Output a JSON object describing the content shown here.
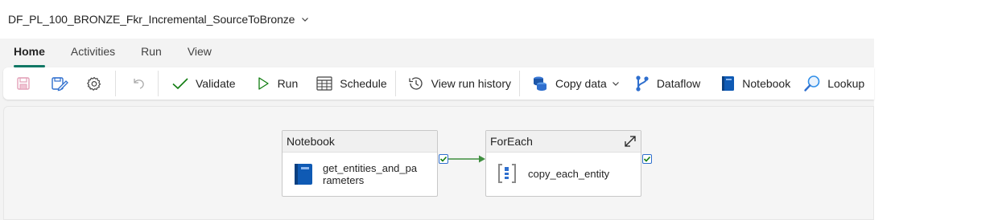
{
  "window": {
    "title": "DF_PL_100_BRONZE_Fkr_Incremental_SourceToBronze"
  },
  "tabs": [
    {
      "label": "Home",
      "active": true
    },
    {
      "label": "Activities",
      "active": false
    },
    {
      "label": "Run",
      "active": false
    },
    {
      "label": "View",
      "active": false
    }
  ],
  "toolbar": {
    "save_icon": "save-icon",
    "save_as_icon": "save-as-icon",
    "settings_icon": "gear-icon",
    "undo_icon": "undo-icon",
    "validate_label": "Validate",
    "run_label": "Run",
    "schedule_label": "Schedule",
    "view_run_history_label": "View run history",
    "copy_data_label": "Copy data",
    "dataflow_label": "Dataflow",
    "notebook_label": "Notebook",
    "lookup_label": "Lookup"
  },
  "canvas": {
    "activities": [
      {
        "type": "Notebook",
        "name": "get_entities_and_pa\nrameters",
        "name_line1": "get_entities_and_pa",
        "name_line2": "rameters"
      },
      {
        "type": "ForEach",
        "name": "copy_each_entity"
      }
    ]
  },
  "colors": {
    "accent": "#117865",
    "success": "#107c10",
    "link_blue": "#2f6fce",
    "notebook_blue": "#0f5ab4"
  }
}
